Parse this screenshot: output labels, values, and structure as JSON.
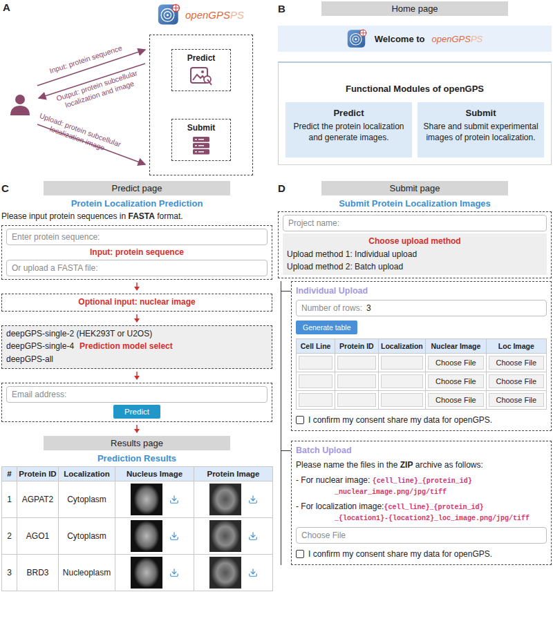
{
  "panel_a": {
    "letter": "A",
    "logo": {
      "text": "openGPS",
      "ghost": "PS"
    },
    "modules": [
      {
        "title": "Predict",
        "kind": "predict"
      },
      {
        "title": "Submit",
        "kind": "submit"
      }
    ],
    "arrows": [
      {
        "lines": [
          "Input: protein sequence"
        ]
      },
      {
        "lines": [
          "Output: protein subcellular",
          "localization and image"
        ]
      },
      {
        "lines": [
          "Upload: protein subcellular",
          "localization image"
        ]
      }
    ]
  },
  "panel_b": {
    "letter": "B",
    "header": "Home page",
    "welcome": "Welcome to",
    "logo": {
      "text": "openGPS",
      "ghost": "PS"
    },
    "modules_title": "Functional Modules of openGPS",
    "cards": [
      {
        "title": "Predict",
        "text": "Predict the protein localization and generate images."
      },
      {
        "title": "Submit",
        "text": "Share and submit experimental images of protein localization."
      }
    ]
  },
  "panel_c": {
    "letter": "C",
    "header": "Predict page",
    "title": "Protein Localization Prediction",
    "instruction": {
      "before": "Please input protein sequences in ",
      "bold": "FASTA",
      "after": " format."
    },
    "sequence_placeholder": "Enter protein sequence:",
    "file_placeholder": "Or upload a FASTA file:",
    "input_label": "Input: protein sequence",
    "optional_label": "Optional input: nuclear image",
    "models": [
      "deepGPS-single-2 (HEK293T or U2OS)",
      "deepGPS-single-4",
      "deepGPS-all"
    ],
    "model_label": "Prediction model select",
    "email_placeholder": "Email address:",
    "button": "Predict",
    "results": {
      "header": "Results page",
      "title": "Prediction Results",
      "columns": [
        "#",
        "Protein ID",
        "Localization",
        "Nucleus Image",
        "Protein Image"
      ],
      "rows": [
        {
          "index": "1",
          "protein_id": "AGPAT2",
          "localization": "Cytoplasm"
        },
        {
          "index": "2",
          "protein_id": "AGO1",
          "localization": "Cytoplasm"
        },
        {
          "index": "3",
          "protein_id": "BRD3",
          "localization": "Nucleoplasm"
        }
      ]
    }
  },
  "panel_d": {
    "letter": "D",
    "header": "Submit page",
    "title": "Submit Protein Localization Images",
    "project_placeholder": "Project name:",
    "method_title": "Choose upload method",
    "methods": [
      "Upload method 1: Individual upload",
      "Upload method 2: Batch upload"
    ],
    "individual": {
      "title": "Individual Upload",
      "rows_label": "Number of rows:",
      "rows_value": "3",
      "button": "Generate table",
      "columns": [
        "Cell Line",
        "Protein ID",
        "Localization",
        "Nuclear Image",
        "Loc Image"
      ],
      "rows": [
        {
          "cell_line": "",
          "protein_id": "",
          "localization": "",
          "nuclear": "Choose File",
          "loc": "Choose File"
        },
        {
          "cell_line": "",
          "protein_id": "",
          "localization": "",
          "nuclear": "Choose File",
          "loc": "Choose File"
        },
        {
          "cell_line": "",
          "protein_id": "",
          "localization": "",
          "nuclear": "Choose File",
          "loc": "Choose File"
        }
      ],
      "consent": {
        "text": "I confirm my consent share my data for openGPS.",
        "checked": false
      }
    },
    "batch": {
      "title": "Batch Upload",
      "intro": {
        "before": "Please name the files in the ",
        "bold": "ZIP",
        "after": " archive as follows:"
      },
      "rules": [
        {
          "label": "- For nuclear image: ",
          "code": [
            "{cell_line}_{protein_id}",
            "_nuclear_image.png/jpg/tiff"
          ]
        },
        {
          "label": "- For localization image:",
          "code": [
            "{cell_line}_{protein_id}",
            "_{location1}-{location2}_loc_image.png/jpg/tiff"
          ]
        }
      ],
      "file_button": "Choose File",
      "consent": {
        "text": "I confirm my consent share my data for openGPS.",
        "checked": false
      }
    }
  }
}
